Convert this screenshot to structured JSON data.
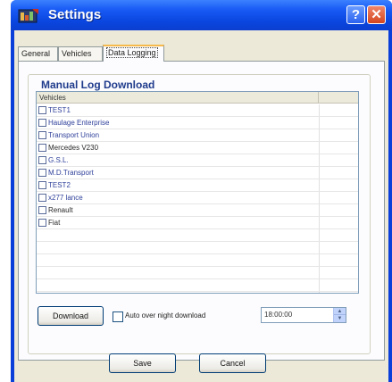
{
  "window": {
    "title": "Settings",
    "help_label": "?",
    "close_label": "✕",
    "app_icon": "settings-app-icon"
  },
  "tabs": [
    {
      "label": "General",
      "active": false
    },
    {
      "label": "Vehicles",
      "active": false
    },
    {
      "label": "Data Logging",
      "active": true
    }
  ],
  "group": {
    "title": "Manual Log Download"
  },
  "list": {
    "column_header": "Vehicles",
    "rows": [
      {
        "label": "TEST1",
        "checked": false
      },
      {
        "label": "Haulage Enterprise",
        "checked": false
      },
      {
        "label": "Transport Union",
        "checked": false
      },
      {
        "label": "Mercedes V230",
        "checked": false
      },
      {
        "label": "G.S.L.",
        "checked": false
      },
      {
        "label": "M.D.Transport",
        "checked": false
      },
      {
        "label": "TEST2",
        "checked": false
      },
      {
        "label": "x277 lance",
        "checked": false
      },
      {
        "label": "Renault",
        "checked": false
      },
      {
        "label": "Fiat",
        "checked": false
      }
    ]
  },
  "controls": {
    "download_label": "Download",
    "auto_download_label": "Auto over night download",
    "auto_download_checked": false,
    "time_value": "18:00:00"
  },
  "footer": {
    "save_label": "Save",
    "cancel_label": "Cancel"
  }
}
